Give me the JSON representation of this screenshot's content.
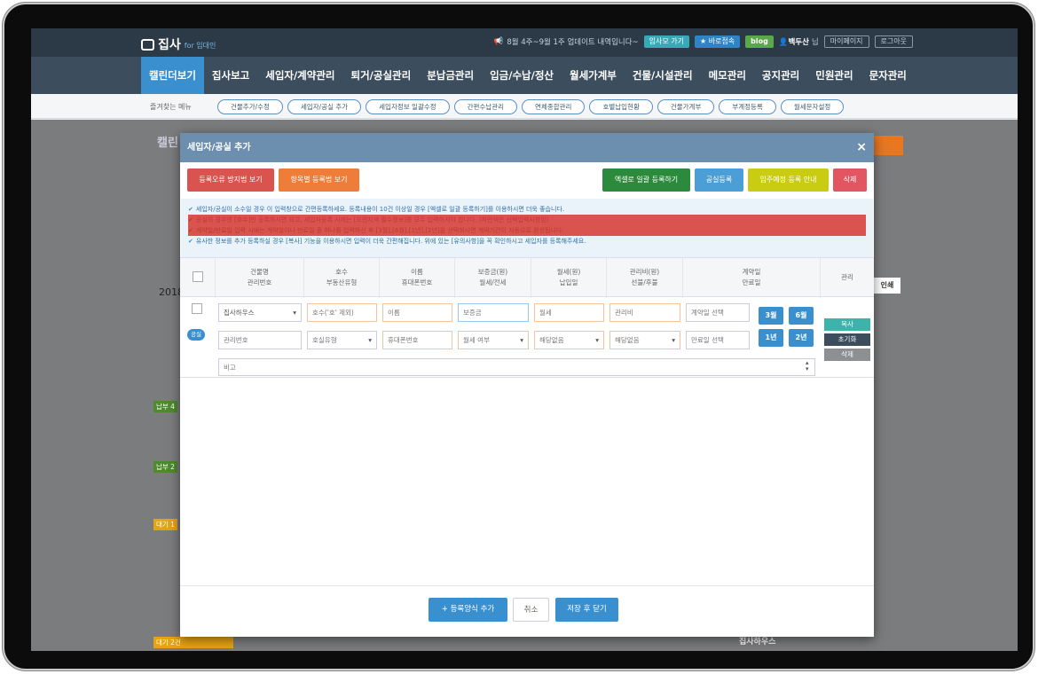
{
  "header": {
    "logo_text": "집사",
    "logo_sub": "for 임대인",
    "notice": "8월 4주~9월 1주 업데이트 내역입니다~",
    "btn_jipsamo": "임사모 가기",
    "btn_quick": "★ 바로접속",
    "btn_blog": "blog",
    "user_name": "백두산",
    "user_suffix": "님",
    "btn_mypage": "마이페이지",
    "btn_logout": "로그아웃"
  },
  "nav": [
    "캘린더보기",
    "집사보고",
    "세입자/계약관리",
    "퇴거/공실관리",
    "분납금관리",
    "입금/수납/정산",
    "월세가계부",
    "건물/시설관리",
    "메모관리",
    "공지관리",
    "민원관리",
    "문자관리"
  ],
  "favorites": {
    "label": "즐겨찾는 메뉴",
    "items": [
      "건물추가/수정",
      "세입자/공실 추가",
      "세입자정보 일괄수정",
      "간편수납관리",
      "연체종합관리",
      "호별납입현황",
      "건물가계부",
      "부계정등록",
      "월세문자설정"
    ]
  },
  "background": {
    "title": "캘린",
    "year": "2018",
    "tags": [
      "납부 4",
      "납부 2",
      "대기 1",
      "대기 2건"
    ],
    "print": "인쇄",
    "bottom_building": "집사하우스"
  },
  "modal": {
    "title": "세입자/공실 추가",
    "close": "×",
    "toolbar": {
      "error_tip": "등록오류 방지법 보기",
      "item_tip": "항목별 등록법 보기",
      "excel": "엑셀로 일괄 등록하기",
      "vacancy": "공실등록",
      "move_in": "입주예정 등록 안내",
      "delete": "삭제"
    },
    "notes": [
      "세입자/공실이 소수일 경우 이 입력창으로 간편등록하세요. 등록내용이 10건 이상일 경우 [엑셀로 일괄 등록하기]를 이용하시면 더욱 좋습니다.",
      "공실의 경우엔 [호수]만 등록하시면 되고, 세입자등록 시에는 [오렌지색 필수정보]를 모두 입력하셔야 합니다. (파란색은 선택입력사항임)",
      "계약일/만료일 입력 시에는 계약일이나 만료일 중 하나를 입력하신 후 [3월],[6월],[1년],[2년]을 선택하시면 계약기간이 자동으로 완성됩니다.",
      "유사한 정보를 추가 등록하실 경우 [복사] 기능을 이용하시면 입력이 더욱 간편해집니다. 위에 있는 [유의사항]을 꼭 확인하시고 세입자를 등록해주세요."
    ],
    "columns": [
      [
        "건물명",
        "관리번호"
      ],
      [
        "호수",
        "부동산유형"
      ],
      [
        "이름",
        "휴대폰번호"
      ],
      [
        "보증금(원)",
        "월세/전세"
      ],
      [
        "월세(원)",
        "납입일"
      ],
      [
        "관리비(원)",
        "선불/후불"
      ],
      [
        "계약일",
        "만료일"
      ],
      [
        "관리"
      ]
    ],
    "row": {
      "badge": "공실",
      "building": "집사하우스",
      "mgmt_no": "관리번호",
      "unit": "호수('호' 제외)",
      "prop_type": "호실유형",
      "name": "이름",
      "phone": "휴대폰번호",
      "deposit": "보증금",
      "rent_type": "월세 여부",
      "rent": "월세",
      "pay_day": "해당없음",
      "fee": "관리비",
      "fee_type": "해당없음",
      "contract": "계약일 선택",
      "expire": "만료일 선택",
      "p3m": "3월",
      "p6m": "6월",
      "p1y": "1년",
      "p2y": "2년",
      "copy": "복사",
      "reset": "초기화",
      "del": "삭제",
      "memo": "비고"
    },
    "footer": {
      "add_form": "+ 등록양식 추가",
      "cancel": "취소",
      "save": "저장 후 닫기"
    }
  }
}
